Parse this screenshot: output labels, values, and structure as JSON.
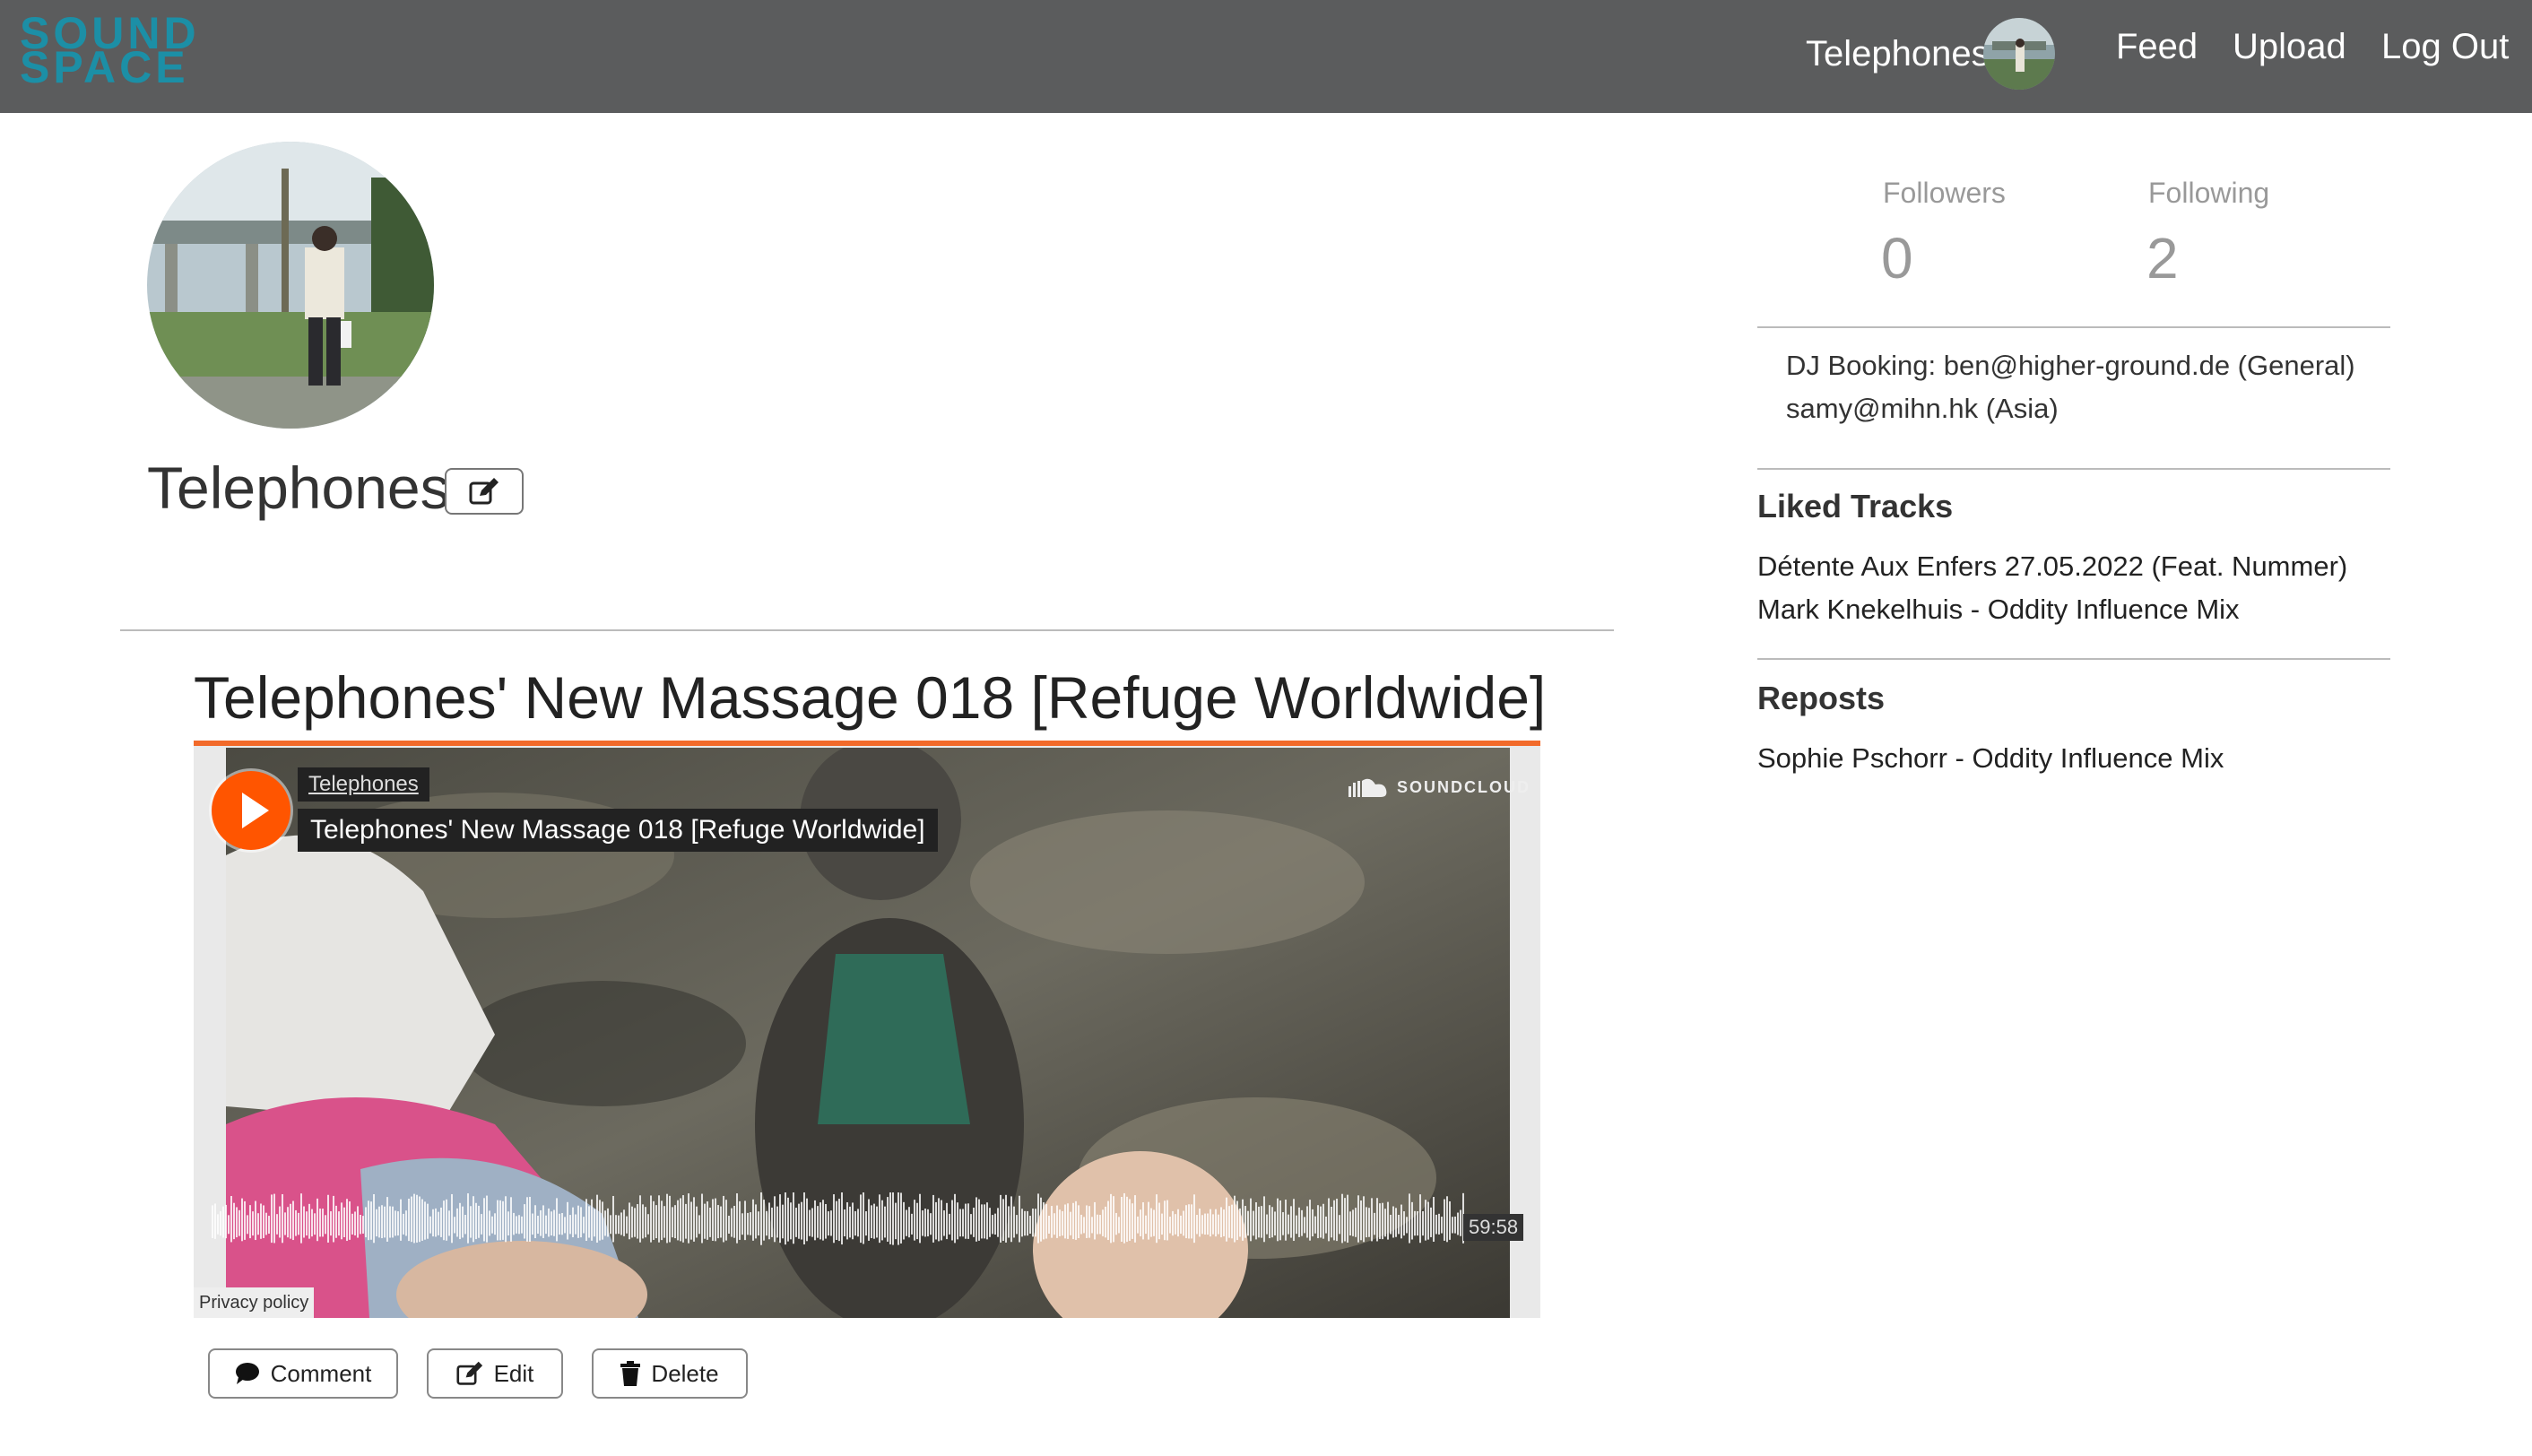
{
  "nav": {
    "logo_line1": "SOUND",
    "logo_line2": "SPACE",
    "username": "Telephones",
    "links": [
      "Feed",
      "Upload",
      "Log Out"
    ]
  },
  "profile": {
    "username": "Telephones",
    "followers_label": "Followers",
    "followers_count": "0",
    "following_label": "Following",
    "following_count": "2",
    "bio_line1": "DJ Booking: ben@higher-ground.de (General)",
    "bio_line2": "samy@mihn.hk (Asia)"
  },
  "track": {
    "title": "Telephones' New Massage 018 [Refuge Worldwide]",
    "embed": {
      "artist": "Telephones",
      "title": "Telephones' New Massage 018 [Refuge Worldwide]",
      "brand": "SOUNDCLOUD",
      "duration": "59:58",
      "privacy": "Privacy policy"
    },
    "actions": {
      "comment": "Comment",
      "edit": "Edit",
      "delete": "Delete"
    }
  },
  "liked": {
    "heading": "Liked Tracks",
    "items": [
      "Détente Aux Enfers 27.05.2022 (Feat. Nummer)",
      "Mark Knekelhuis - Oddity Influence Mix"
    ]
  },
  "reposts": {
    "heading": "Reposts",
    "items": [
      "Sophie Pschorr - Oddity Influence Mix"
    ]
  },
  "colors": {
    "navbar": "#5b5c5d",
    "logo": "#1c8fa6",
    "soundcloud_orange": "#ff5500"
  }
}
